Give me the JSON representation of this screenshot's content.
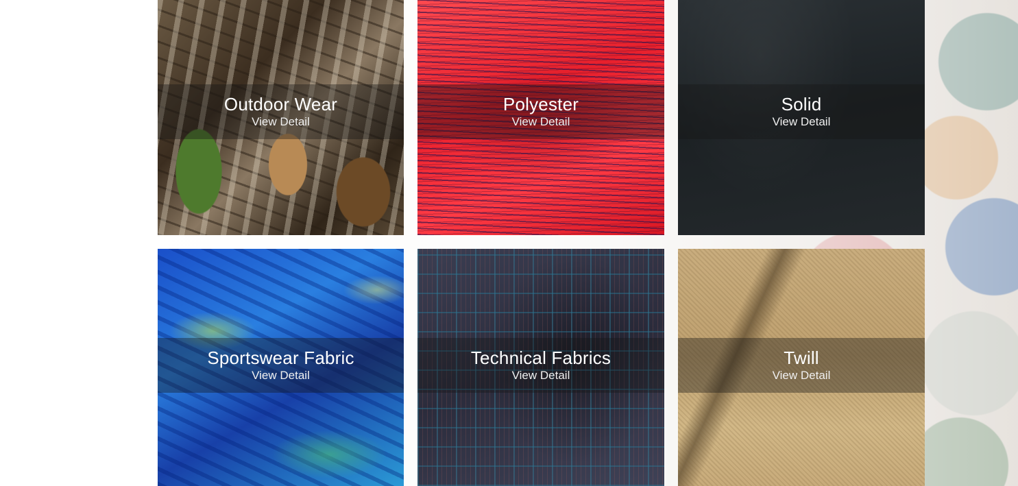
{
  "categories": [
    {
      "title": "Outdoor Wear",
      "link": "View Detail"
    },
    {
      "title": "Polyester",
      "link": "View Detail"
    },
    {
      "title": "Solid",
      "link": "View Detail"
    },
    {
      "title": "Sportswear Fabric",
      "link": "View Detail"
    },
    {
      "title": "Technical Fabrics",
      "link": "View Detail"
    },
    {
      "title": "Twill",
      "link": "View Detail"
    }
  ]
}
